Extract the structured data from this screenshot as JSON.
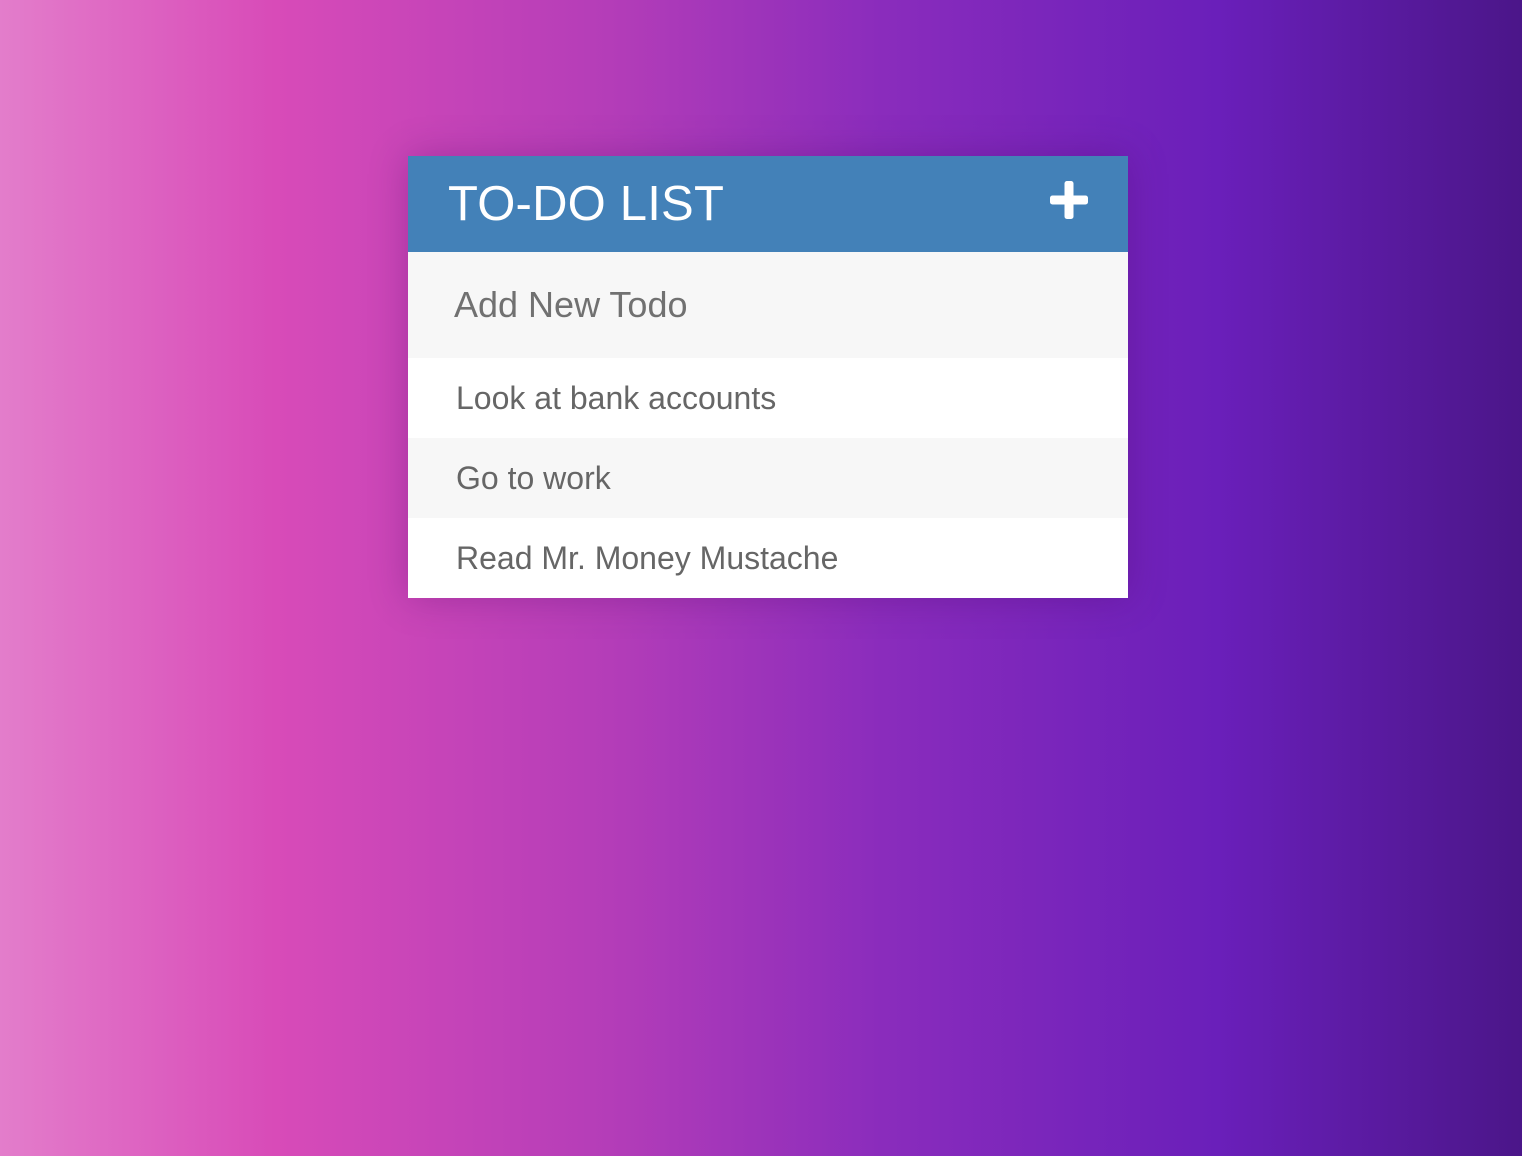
{
  "header": {
    "title": "TO-DO LIST",
    "add_icon": "plus-icon"
  },
  "new_todo": {
    "placeholder": "Add New Todo",
    "value": ""
  },
  "todos": [
    {
      "text": "Look at bank accounts"
    },
    {
      "text": "Go to work"
    },
    {
      "text": "Read Mr. Money Mustache"
    }
  ],
  "colors": {
    "header": "#4381b8",
    "header_text": "#ffffff",
    "row_light": "#ffffff",
    "row_alt": "#f7f7f7",
    "item_text": "#666666"
  }
}
